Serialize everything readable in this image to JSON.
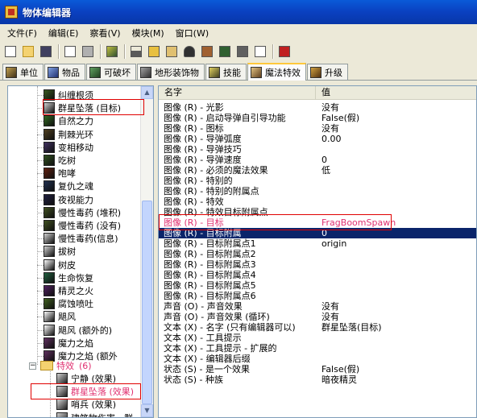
{
  "window": {
    "title": "物体编辑器"
  },
  "menu": [
    "文件(F)",
    "编辑(E)",
    "察看(V)",
    "模块(M)",
    "窗口(W)"
  ],
  "toolbar_icons": [
    "new-file-icon",
    "open-folder-icon",
    "save-icon",
    "copy-icon",
    "paste-icon",
    "unit-editor-icon",
    "terrain-icon",
    "text-icon",
    "sound-icon",
    "lock-icon",
    "bridge-icon",
    "stone-icon",
    "cube-icon",
    "export-icon",
    "import-icon"
  ],
  "tabs": [
    {
      "label": "单位",
      "icon": "unit-icon"
    },
    {
      "label": "物品",
      "icon": "item-icon"
    },
    {
      "label": "可破坏",
      "icon": "destructible-icon"
    },
    {
      "label": "地形装饰物",
      "icon": "doodad-icon"
    },
    {
      "label": "技能",
      "icon": "ability-icon"
    },
    {
      "label": "魔法特效",
      "icon": "buff-icon",
      "active": true
    },
    {
      "label": "升级",
      "icon": "upgrade-icon"
    }
  ],
  "tree": {
    "items": [
      {
        "label": "纠缠根须",
        "icon_color": "#3a5a20"
      },
      {
        "label": "群星坠落 (目标)",
        "icon_color": "#d0d0d0"
      },
      {
        "label": "自然之力",
        "icon_color": "#306820"
      },
      {
        "label": "荆棘光环",
        "icon_color": "#504020"
      },
      {
        "label": "变相移动",
        "icon_color": "#403060"
      },
      {
        "label": "吃树",
        "icon_color": "#305020"
      },
      {
        "label": "咆哮",
        "icon_color": "#602010"
      },
      {
        "label": "复仇之魂",
        "icon_color": "#203050"
      },
      {
        "label": "夜视能力",
        "icon_color": "#202040"
      },
      {
        "label": "慢性毒药 (堆积)",
        "icon_color": "#405020"
      },
      {
        "label": "慢性毒药 (没有)",
        "icon_color": "#405020"
      },
      {
        "label": "慢性毒药(信息)",
        "icon_color": "#d0d0d0"
      },
      {
        "label": "拔树",
        "icon_color": "#d0d0d0"
      },
      {
        "label": "树皮",
        "icon_color": "#ffffff"
      },
      {
        "label": "生命恢复",
        "icon_color": "#206040"
      },
      {
        "label": "精灵之火",
        "icon_color": "#502060"
      },
      {
        "label": "腐蚀喷吐",
        "icon_color": "#406020"
      },
      {
        "label": "飓风",
        "icon_color": "#ffffff"
      },
      {
        "label": "飓风 (额外的)",
        "icon_color": "#ffffff"
      },
      {
        "label": "魔力之焰",
        "icon_color": "#603060"
      },
      {
        "label": "魔力之焰 (额外",
        "icon_color": "#603060"
      }
    ],
    "folder": {
      "label": "特效",
      "count": "(6)"
    },
    "sub_items": [
      {
        "label": "宁静 (效果)"
      },
      {
        "label": "群星坠落 (效果)",
        "pink": true
      },
      {
        "label": "哨兵 (效果)"
      },
      {
        "label": "建筑物伤害 - 群"
      }
    ]
  },
  "properties": {
    "col_name": "名字",
    "col_value": "值",
    "rows": [
      {
        "k": "图像 (R) - 光影",
        "v": "没有"
      },
      {
        "k": "图像 (R) - 启动导弹自引导功能",
        "v": "False(假)"
      },
      {
        "k": "图像 (R) - 图标",
        "v": "没有"
      },
      {
        "k": "图像 (R) - 导弹弧度",
        "v": "0.00"
      },
      {
        "k": "图像 (R) - 导弹技巧",
        "v": ""
      },
      {
        "k": "图像 (R) - 导弹速度",
        "v": "0"
      },
      {
        "k": "图像 (R) - 必须的魔法效果",
        "v": "低"
      },
      {
        "k": "图像 (R) - 特别的",
        "v": ""
      },
      {
        "k": "图像 (R) - 特别的附属点",
        "v": ""
      },
      {
        "k": "图像 (R) - 特效",
        "v": ""
      },
      {
        "k": "图像 (R) - 特效目标附属点",
        "v": ""
      },
      {
        "k": "图像 (R) - 目标",
        "v": "FragBoomSpawn",
        "pink": true
      },
      {
        "k": "图像 (R) - 目标附属",
        "v": "0",
        "selected": true
      },
      {
        "k": "图像 (R) - 目标附属点1",
        "v": "origin"
      },
      {
        "k": "图像 (R) - 目标附属点2",
        "v": ""
      },
      {
        "k": "图像 (R) - 目标附属点3",
        "v": ""
      },
      {
        "k": "图像 (R) - 目标附属点4",
        "v": ""
      },
      {
        "k": "图像 (R) - 目标附属点5",
        "v": ""
      },
      {
        "k": "图像 (R) - 目标附属点6",
        "v": ""
      },
      {
        "k": "声音 (O) - 声音效果",
        "v": "没有"
      },
      {
        "k": "声音 (O) - 声音效果 (循环)",
        "v": "没有"
      },
      {
        "k": "文本 (X) - 名字 (只有编辑器可以)",
        "v": "群星坠落(目标)"
      },
      {
        "k": "文本 (X) - 工具提示",
        "v": ""
      },
      {
        "k": "文本 (X) - 工具提示 - 扩展的",
        "v": ""
      },
      {
        "k": "文本 (X) - 编辑器后缀",
        "v": ""
      },
      {
        "k": "状态 (S) - 是一个效果",
        "v": "False(假)"
      },
      {
        "k": "状态 (S) - 种族",
        "v": "暗夜精灵"
      }
    ]
  }
}
